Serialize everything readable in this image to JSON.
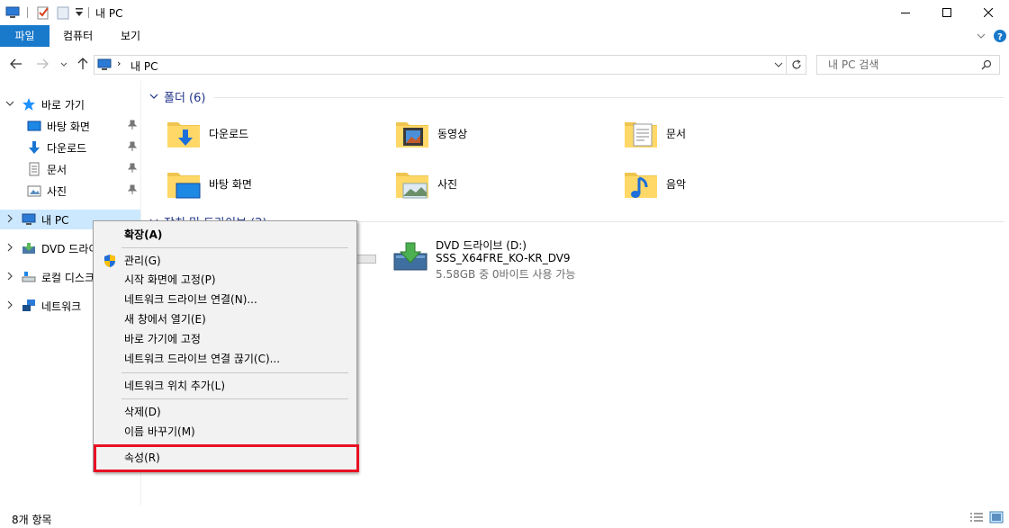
{
  "window": {
    "title": "내 PC"
  },
  "ribbon": {
    "tabs": [
      {
        "label": "파일"
      },
      {
        "label": "컴퓨터"
      },
      {
        "label": "보기"
      }
    ]
  },
  "address": {
    "crumb": "내 PC",
    "search_placeholder": "내 PC 검색"
  },
  "sidebar": {
    "quick_access": "바로 가기",
    "pinned": [
      {
        "label": "바탕 화면",
        "icon": "desktop-icon"
      },
      {
        "label": "다운로드",
        "icon": "download-icon"
      },
      {
        "label": "문서",
        "icon": "document-icon"
      },
      {
        "label": "사진",
        "icon": "pictures-icon"
      }
    ],
    "roots": [
      {
        "label": "내 PC",
        "icon": "computer-icon"
      },
      {
        "label": "DVD 드라이",
        "icon": "dvd-drive-icon"
      },
      {
        "label": "로컬 디스크",
        "icon": "local-disk-icon"
      },
      {
        "label": "네트워크",
        "icon": "network-icon"
      }
    ]
  },
  "content": {
    "folders_header": "폴더 (6)",
    "folders": [
      {
        "label": "다운로드",
        "icon": "download-folder-icon"
      },
      {
        "label": "동영상",
        "icon": "videos-folder-icon"
      },
      {
        "label": "문서",
        "icon": "documents-folder-icon"
      },
      {
        "label": "바탕 화면",
        "icon": "desktop-folder-icon"
      },
      {
        "label": "사진",
        "icon": "pictures-folder-icon"
      },
      {
        "label": "음악",
        "icon": "music-folder-icon"
      }
    ],
    "devices_header": "장치 및 드라이브 (2)",
    "dvd": {
      "name": "DVD 드라이브 (D:)",
      "volume": "SSS_X64FRE_KO-KR_DV9",
      "free": "5.58GB 중 0바이트 사용 가능"
    }
  },
  "context_menu": {
    "items": [
      {
        "label": "확장(A)"
      },
      {
        "label": "관리(G)"
      },
      {
        "label": "시작 화면에 고정(P)"
      },
      {
        "label": "네트워크 드라이브 연결(N)..."
      },
      {
        "label": "새 창에서 열기(E)"
      },
      {
        "label": "바로 가기에 고정"
      },
      {
        "label": "네트워크 드라이브 연결 끊기(C)..."
      },
      {
        "label": "네트워크 위치 추가(L)"
      },
      {
        "label": "삭제(D)"
      },
      {
        "label": "이름 바꾸기(M)"
      },
      {
        "label": "속성(R)"
      }
    ]
  },
  "status": {
    "count": "8개 항목"
  },
  "colors": {
    "accent": "#1979ca",
    "header_text": "#1e3287",
    "highlight_box": "#e81123",
    "selected_bg": "#cce8ff"
  }
}
